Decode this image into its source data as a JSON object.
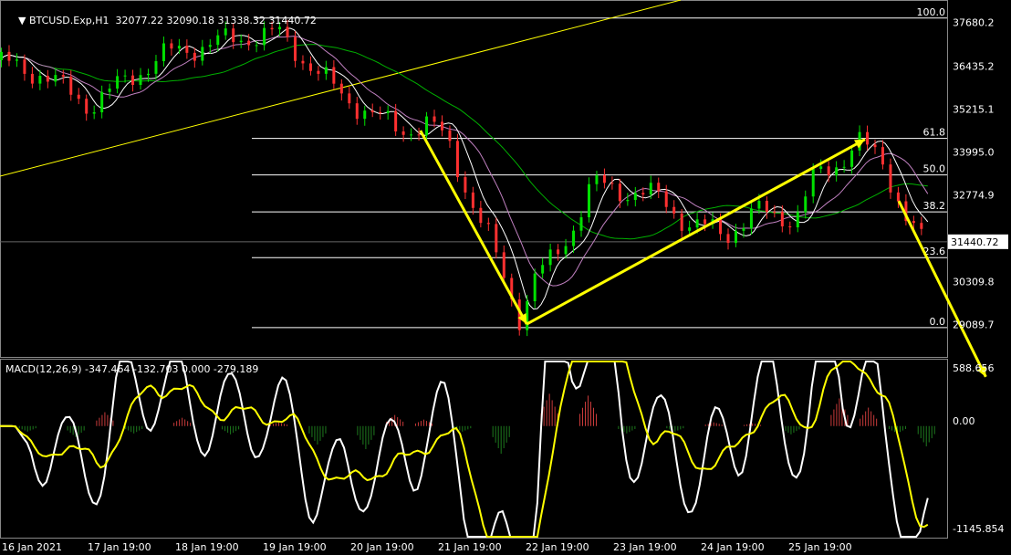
{
  "header": {
    "symbol_line": "BTCUSD.Exp,H1  32077.22 32090.18 31338.32 31440.72",
    "macd_line": "MACD(12,26,9) -347.464 -132.703 0.000 -279.189"
  },
  "colors": {
    "background": "#000000",
    "bull_candle": "#00e000",
    "bear_candle": "#ff3030",
    "fib_line": "#ffffff",
    "trend_line": "#ffff00",
    "arrow": "#ffff00",
    "ma_green": "#00b000",
    "ma_pink": "#c080c0",
    "ma_white": "#ffffff",
    "macd_main": "#ffffff",
    "macd_signal": "#ffff00",
    "hist_pos": "#c83a3a",
    "hist_neg": "#1e7a1e",
    "price_marker_bg": "#ffffff",
    "grid_text": "#ffffff"
  },
  "chart_data": [
    {
      "type": "candlestick",
      "symbol": "BTCUSD.Exp",
      "timeframe": "H1",
      "ohlc_current": {
        "open": 32077.22,
        "high": 32090.18,
        "low": 31338.32,
        "close": 31440.72
      },
      "price_axis_ticks": [
        37680.2,
        36435.2,
        35215.1,
        33995.0,
        32774.9,
        31440.72,
        30309.8,
        29089.7
      ],
      "current_price_label": "31440.72",
      "ylim": [
        28400,
        37950
      ],
      "x_tick_labels": [
        "16 Jan 2021",
        "17 Jan 19:00",
        "18 Jan 19:00",
        "19 Jan 19:00",
        "20 Jan 19:00",
        "21 Jan 19:00",
        "22 Jan 19:00",
        "23 Jan 19:00",
        "24 Jan 19:00",
        "25 Jan 19:00"
      ],
      "series": [
        {
          "name": "close_path",
          "points": [
            [
              0,
              36600
            ],
            [
              0.5,
              36200
            ],
            [
              1,
              35300
            ],
            [
              1.4,
              36100
            ],
            [
              1.8,
              36800
            ],
            [
              2.3,
              37100
            ],
            [
              2.7,
              37300
            ],
            [
              2.95,
              37350
            ],
            [
              3.3,
              36400
            ],
            [
              3.6,
              35600
            ],
            [
              4.2,
              34600
            ],
            [
              4.5,
              34800
            ],
            [
              4.7,
              34300
            ],
            [
              5.0,
              32200
            ],
            [
              5.1,
              31700
            ],
            [
              5.3,
              30300
            ],
            [
              5.45,
              29250
            ],
            [
              5.6,
              30400
            ],
            [
              5.8,
              31000
            ],
            [
              6.0,
              31900
            ],
            [
              6.2,
              33100
            ],
            [
              6.5,
              32900
            ],
            [
              6.9,
              32700
            ],
            [
              7.2,
              31900
            ],
            [
              7.6,
              31700
            ],
            [
              7.9,
              32300
            ],
            [
              8.3,
              32100
            ],
            [
              8.5,
              33300
            ],
            [
              8.7,
              33600
            ],
            [
              8.95,
              34300
            ],
            [
              9.2,
              33700
            ],
            [
              9.45,
              32100
            ],
            [
              9.6,
              31450
            ]
          ]
        }
      ],
      "fibonacci": {
        "levels": [
          {
            "label": "100.0",
            "price": 37800
          },
          {
            "label": "61.8",
            "price": 34380
          },
          {
            "label": "50.0",
            "price": 33340
          },
          {
            "label": "38.2",
            "price": 32290
          },
          {
            "label": "23.6",
            "price": 30990
          },
          {
            "label": "0.0",
            "price": 29000
          }
        ]
      }
    },
    {
      "type": "line",
      "title": "MACD(12,26,9)",
      "values_shown": [
        -347.464,
        -132.703,
        0.0,
        -279.189
      ],
      "axis_ticks": [
        588.656,
        0.0,
        -1145.854
      ],
      "ylim": [
        -1200,
        700
      ],
      "histogram": [
        {
          "x": 0.2,
          "v": -60
        },
        {
          "x": 0.7,
          "v": -120
        },
        {
          "x": 1.0,
          "v": 150
        },
        {
          "x": 1.3,
          "v": -80
        },
        {
          "x": 1.8,
          "v": 90
        },
        {
          "x": 2.3,
          "v": -90
        },
        {
          "x": 2.8,
          "v": 40
        },
        {
          "x": 3.2,
          "v": -200
        },
        {
          "x": 3.7,
          "v": -250
        },
        {
          "x": 4.0,
          "v": 120
        },
        {
          "x": 4.3,
          "v": 70
        },
        {
          "x": 4.7,
          "v": -60
        },
        {
          "x": 5.1,
          "v": -300
        },
        {
          "x": 5.6,
          "v": 350
        },
        {
          "x": 6.0,
          "v": 330
        },
        {
          "x": 6.4,
          "v": -80
        },
        {
          "x": 6.9,
          "v": -60
        },
        {
          "x": 7.3,
          "v": 40
        },
        {
          "x": 7.7,
          "v": 30
        },
        {
          "x": 8.1,
          "v": -90
        },
        {
          "x": 8.6,
          "v": 300
        },
        {
          "x": 8.9,
          "v": 200
        },
        {
          "x": 9.2,
          "v": -80
        },
        {
          "x": 9.5,
          "v": -220
        }
      ]
    }
  ]
}
